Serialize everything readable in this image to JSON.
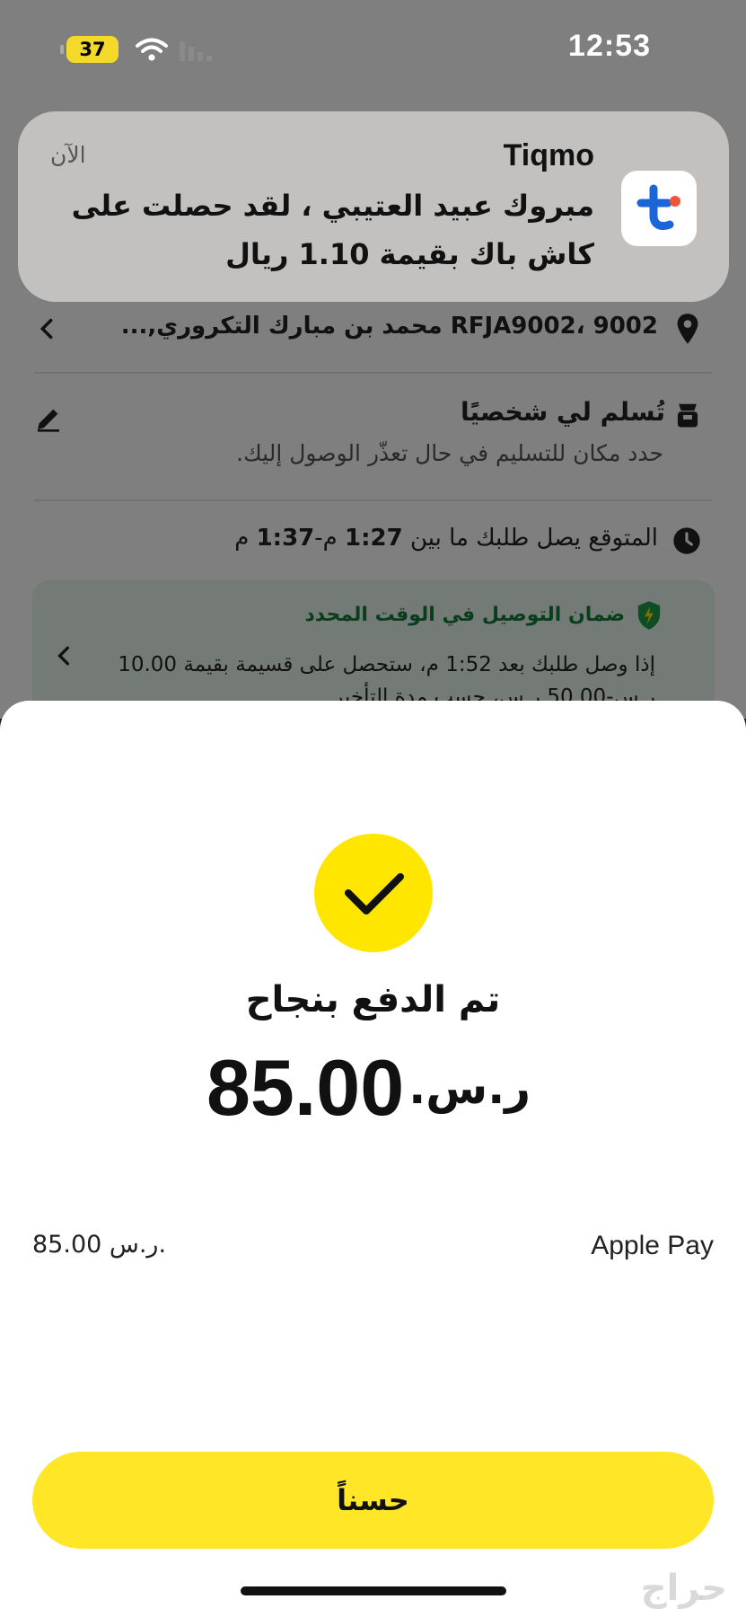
{
  "status_bar": {
    "battery": "37",
    "time": "12:53"
  },
  "background": {
    "address": "9002 ،RFJA9002 محمد بن مبارك التكروري,...",
    "handover_title": "تُسلم لي شخصيًا",
    "handover_subtitle": "حدد مكان للتسليم في حال تعذّر الوصول إليك.",
    "eta_prefix": "المتوقع يصل طلبك ما بين ",
    "eta_from": "1:27",
    "eta_mid": " م-",
    "eta_to": "1:37",
    "eta_suffix": "- م",
    "guarantee_title": "ضمان التوصيل في الوقت المحدد",
    "guarantee_body": "إذا وصل طلبك بعد 1:52 م، ستحصل على قسيمة بقيمة 10.00 ر.س-50.00 ر.س، حسب مدة التأخير."
  },
  "notification": {
    "app_name": "Tiqmo",
    "time": "الآن",
    "body": "مبروك عبيد العتيبي ، لقد حصلت على كاش باك بقيمة 1.10 ريال"
  },
  "sheet": {
    "title": "تم الدفع بنجاح",
    "amount": "85.00",
    "currency": "ر.س.",
    "payment_method": "Apple Pay",
    "payment_amount": "85.00 ر.س.",
    "ok_label": "حسناً"
  },
  "watermark": "حراج",
  "colors": {
    "accent_yellow": "#ffe600",
    "guarantee_green": "#157a3a"
  }
}
